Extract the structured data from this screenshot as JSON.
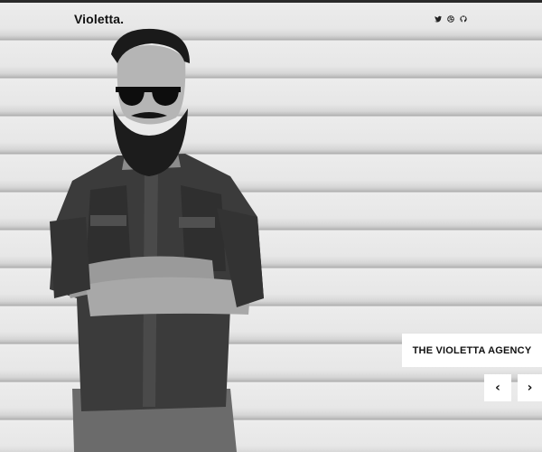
{
  "header": {
    "logo": "Violetta.",
    "social": [
      {
        "icon": "twitter-icon"
      },
      {
        "icon": "dribbble-icon"
      },
      {
        "icon": "github-icon"
      }
    ]
  },
  "slider": {
    "caption": "THE VIOLETTA AGENCY",
    "prev_glyph": "‹",
    "next_glyph": "›"
  },
  "colors": {
    "accent": "#111111",
    "caption_bg": "#ffffff"
  }
}
